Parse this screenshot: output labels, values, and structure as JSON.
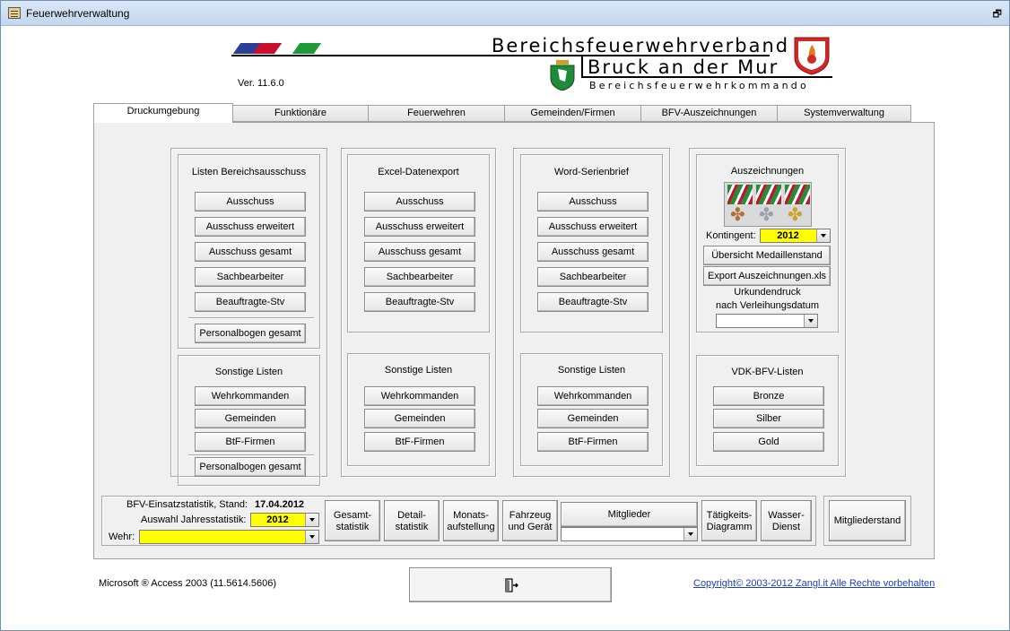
{
  "window": {
    "title": "Feuerwehrverwaltung"
  },
  "header": {
    "org_line1": "Bereichsfeuerwehrverband",
    "org_line2": "Bruck an der Mur",
    "org_line3": "Bereichsfeuerwehrkommando",
    "version": "Ver. 11.6.0"
  },
  "tabs": [
    {
      "label": "Druckumgebung"
    },
    {
      "label": "Funktionäre"
    },
    {
      "label": "Feuerwehren"
    },
    {
      "label": "Gemeinden/Firmen"
    },
    {
      "label": "BFV-Auszeichnungen"
    },
    {
      "label": "Systemverwaltung"
    }
  ],
  "listen": {
    "title": "Listen Bereichsausschuss",
    "buttons": [
      "Ausschuss",
      "Ausschuss erweitert",
      "Ausschuss gesamt",
      "Sachbearbeiter",
      "Beauftragte-Stv",
      "Personalbogen gesamt"
    ],
    "sonstige_title": "Sonstige Listen",
    "sonstige_buttons": [
      "Wehrkommanden",
      "Gemeinden",
      "BtF-Firmen",
      "Personalbogen gesamt"
    ]
  },
  "excel": {
    "title": "Excel-Datenexport",
    "buttons": [
      "Ausschuss",
      "Ausschuss erweitert",
      "Ausschuss gesamt",
      "Sachbearbeiter",
      "Beauftragte-Stv"
    ],
    "sonstige_title": "Sonstige Listen",
    "sonstige_buttons": [
      "Wehrkommanden",
      "Gemeinden",
      "BtF-Firmen"
    ]
  },
  "word": {
    "title": "Word-Serienbrief",
    "buttons": [
      "Ausschuss",
      "Ausschuss erweitert",
      "Ausschuss gesamt",
      "Sachbearbeiter",
      "Beauftragte-Stv"
    ],
    "sonstige_title": "Sonstige Listen",
    "sonstige_buttons": [
      "Wehrkommanden",
      "Gemeinden",
      "BtF-Firmen"
    ]
  },
  "auszeichnungen": {
    "title": "Auszeichnungen",
    "kontingent_label": "Kontingent:",
    "kontingent_value": "2012",
    "btn_uebersicht": "Übersicht Medaillenstand",
    "btn_export": "Export Auszeichnungen.xls",
    "urkunden_line1": "Urkundendruck",
    "urkunden_line2": "nach Verleihungsdatum",
    "urkunden_value": ""
  },
  "vdk": {
    "title": "VDK-BFV-Listen",
    "buttons": [
      "Bronze",
      "Silber",
      "Gold"
    ]
  },
  "statistik": {
    "stand_label": "BFV-Einsatzstatistik, Stand:",
    "stand_value": "17.04.2012",
    "jahr_label": "Auswahl Jahresstatistik:",
    "jahr_value": "2012",
    "wehr_label": "Wehr:",
    "wehr_value": "",
    "btn_gesamt": [
      "Gesamt-",
      "statistik"
    ],
    "btn_detail": [
      "Detail-",
      "statistik"
    ],
    "btn_monat": [
      "Monats-",
      "aufstellung"
    ],
    "btn_fahrzeug": [
      "Fahrzeug",
      "und Gerät"
    ],
    "mitglieder_label": "Mitglieder",
    "mitglieder_value": "",
    "btn_taetigkeit": [
      "Tätigkeits-",
      "Diagramm"
    ],
    "btn_wasser": [
      "Wasser-",
      "Dienst"
    ],
    "btn_mitgliederstand": "Mitgliederstand"
  },
  "footer": {
    "access": "Microsoft ® Access 2003 (11.5614.5606)",
    "copyright": "Copyright© 2003-2012 Zangl.it  Alle Rechte vorbehalten"
  },
  "icons": {
    "app": "notepad-icon",
    "restore": "restore-window-icon",
    "exit": "exit-door-icon"
  },
  "colors": {
    "highlight": "#ffff00",
    "panel": "#f0f0f0",
    "link": "#1a3fb8"
  }
}
